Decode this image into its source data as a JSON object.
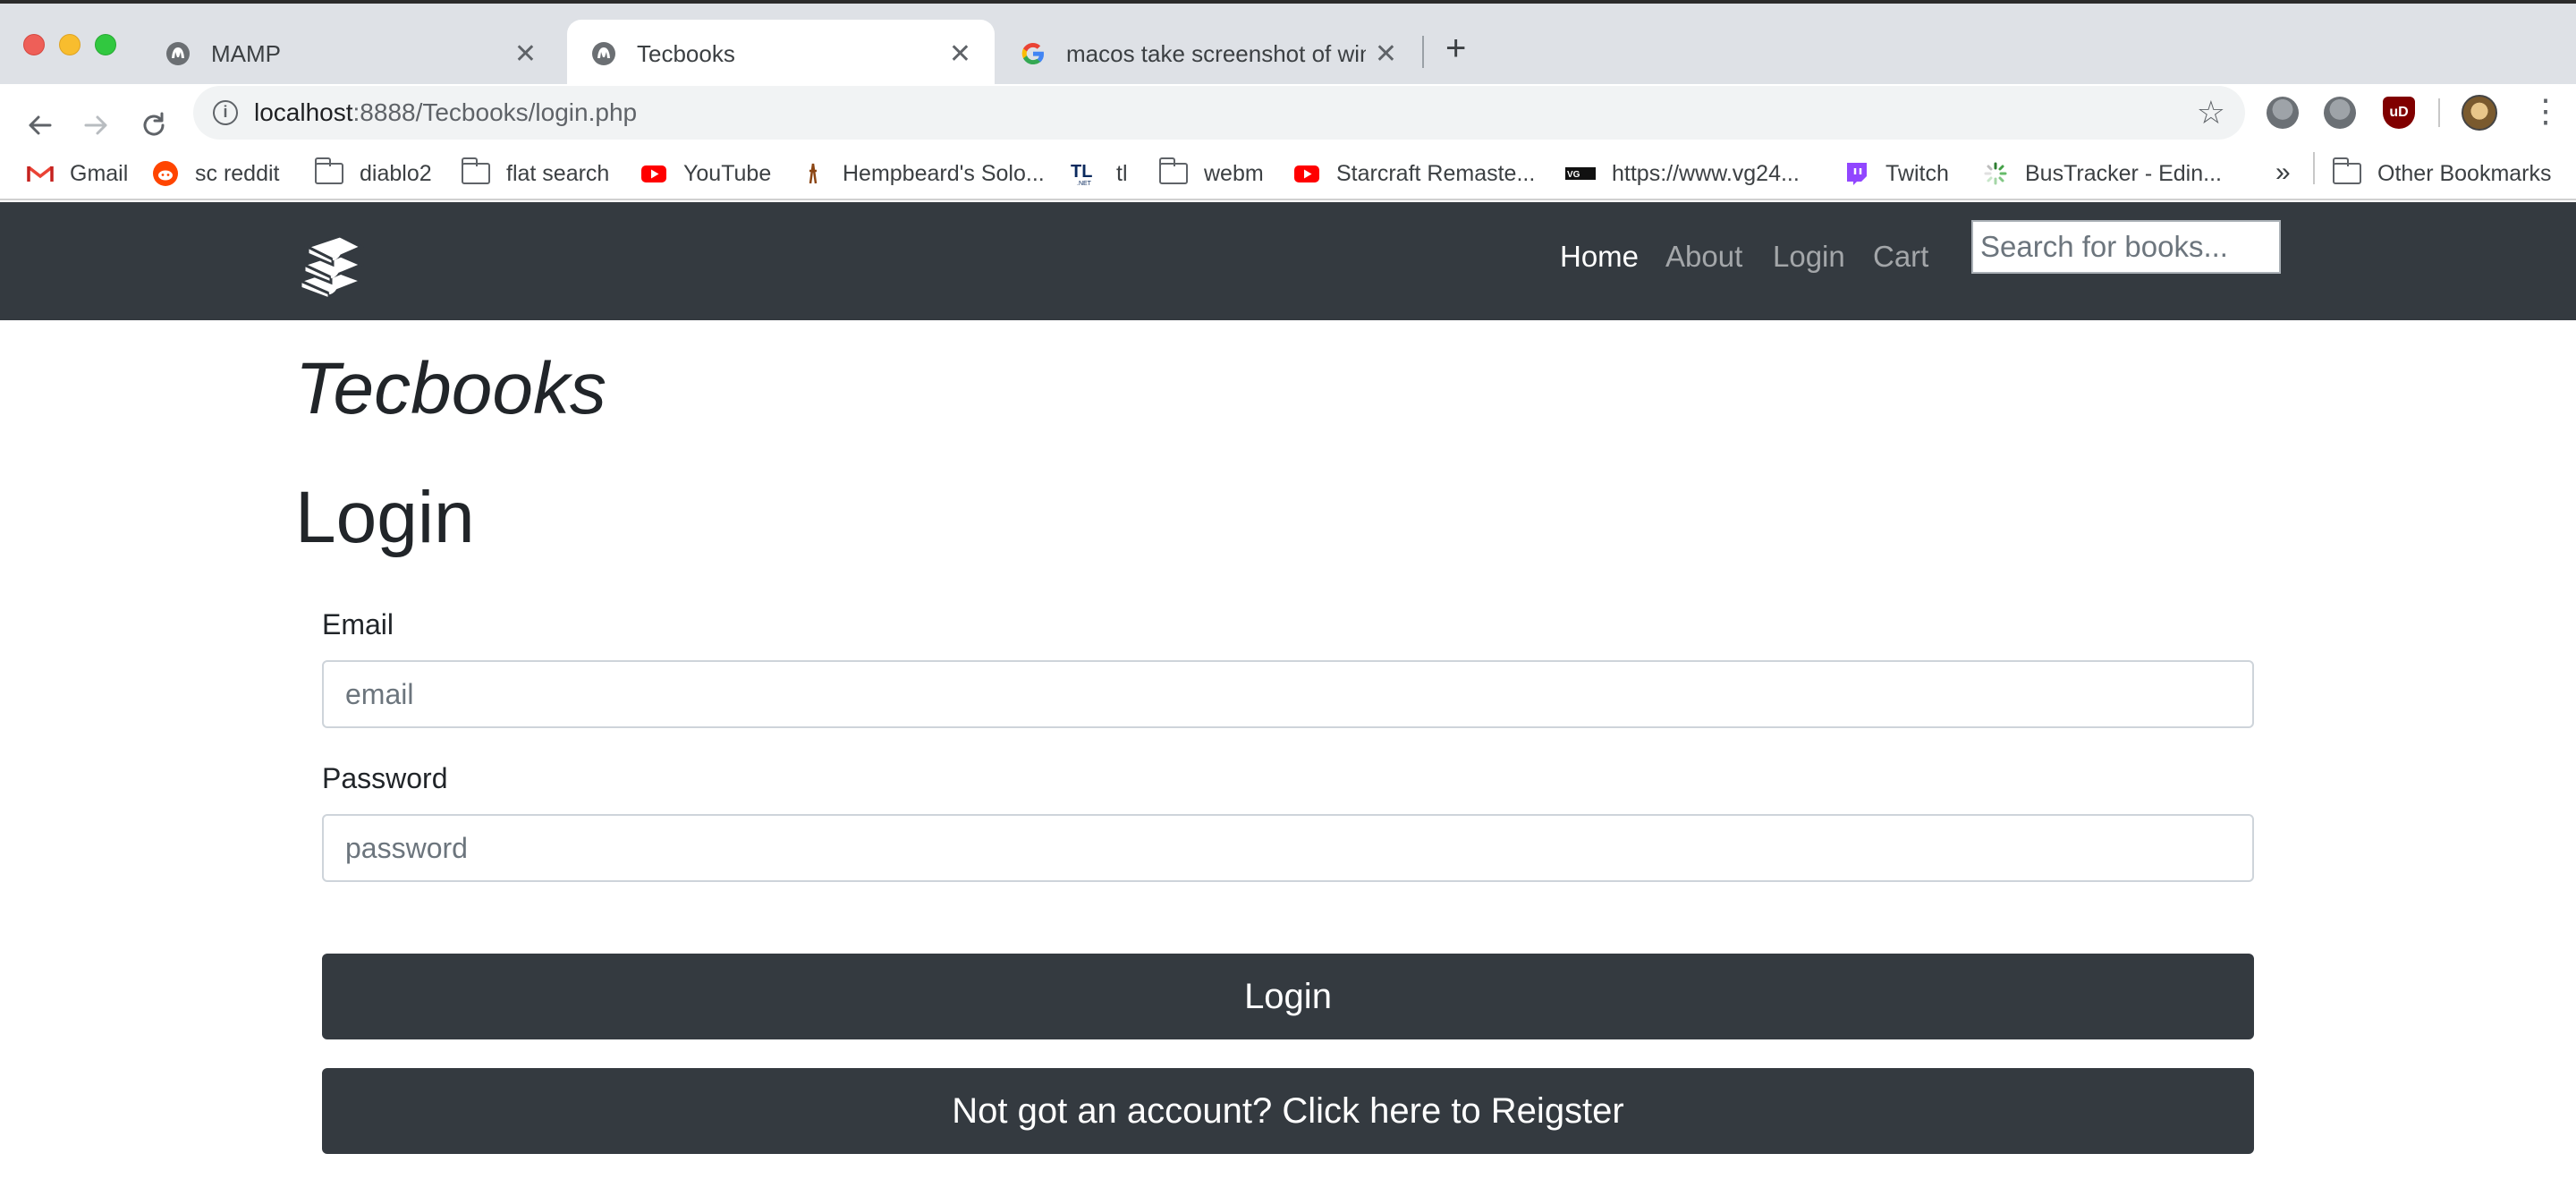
{
  "browser": {
    "tabs": [
      {
        "title": "MAMP",
        "active": false
      },
      {
        "title": "Tecbooks",
        "active": true
      },
      {
        "title": "macos take screenshot of wind",
        "active": false
      }
    ],
    "address_bar": {
      "host": "localhost",
      "rest": ":8888/Tecbooks/login.php"
    },
    "bookmarks": [
      {
        "label": "Gmail",
        "icon": "gmail-icon"
      },
      {
        "label": "sc reddit",
        "icon": "reddit-icon"
      },
      {
        "label": "diablo2",
        "icon": "folder-icon"
      },
      {
        "label": "flat search",
        "icon": "folder-icon"
      },
      {
        "label": "YouTube",
        "icon": "youtube-icon"
      },
      {
        "label": "Hempbeard's Solo...",
        "icon": "hempbeard-icon"
      },
      {
        "label": "tl",
        "icon": "teamliquid-icon"
      },
      {
        "label": "webm",
        "icon": "folder-icon"
      },
      {
        "label": "Starcraft Remaste...",
        "icon": "youtube-icon"
      },
      {
        "label": "https://www.vg24...",
        "icon": "vg247-icon"
      },
      {
        "label": "Twitch",
        "icon": "twitch-icon"
      },
      {
        "label": "BusTracker - Edin...",
        "icon": "loading-icon"
      }
    ],
    "bookmarks_overflow": "»",
    "other_bookmarks": "Other Bookmarks"
  },
  "navbar": {
    "links": [
      "Home",
      "About",
      "Login",
      "Cart"
    ],
    "active_link": "Home",
    "search_placeholder": "Search for books..."
  },
  "page": {
    "site_title": "Tecbooks",
    "heading": "Login",
    "email_label": "Email",
    "email_placeholder": "email",
    "password_label": "Password",
    "password_placeholder": "password",
    "login_button": "Login",
    "register_button": "Not got an account? Click here to Reigster"
  },
  "colors": {
    "navbar_bg": "#343a40",
    "button_bg": "#343a40",
    "tabstrip_bg": "#dee1e6"
  }
}
